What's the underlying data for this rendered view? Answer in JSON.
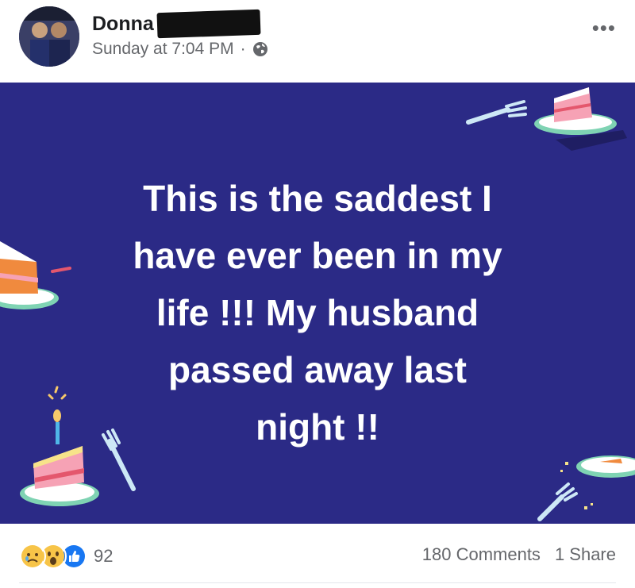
{
  "post": {
    "author": "Donna",
    "timestamp": "Sunday at 7:04 PM",
    "separator": "·",
    "privacy_icon": "globe-icon",
    "more_icon": "more-options-icon",
    "more_label": "•••",
    "text": "This is the saddest I\nhave ever been in my\nlife   !!! My husband\npassed away last\nnight !!",
    "background_color": "#2b2a86"
  },
  "footer": {
    "reaction_icons": [
      "sad-icon",
      "wow-icon",
      "like-icon"
    ],
    "reaction_count": "92",
    "comments": "180 Comments",
    "shares": "1 Share"
  }
}
